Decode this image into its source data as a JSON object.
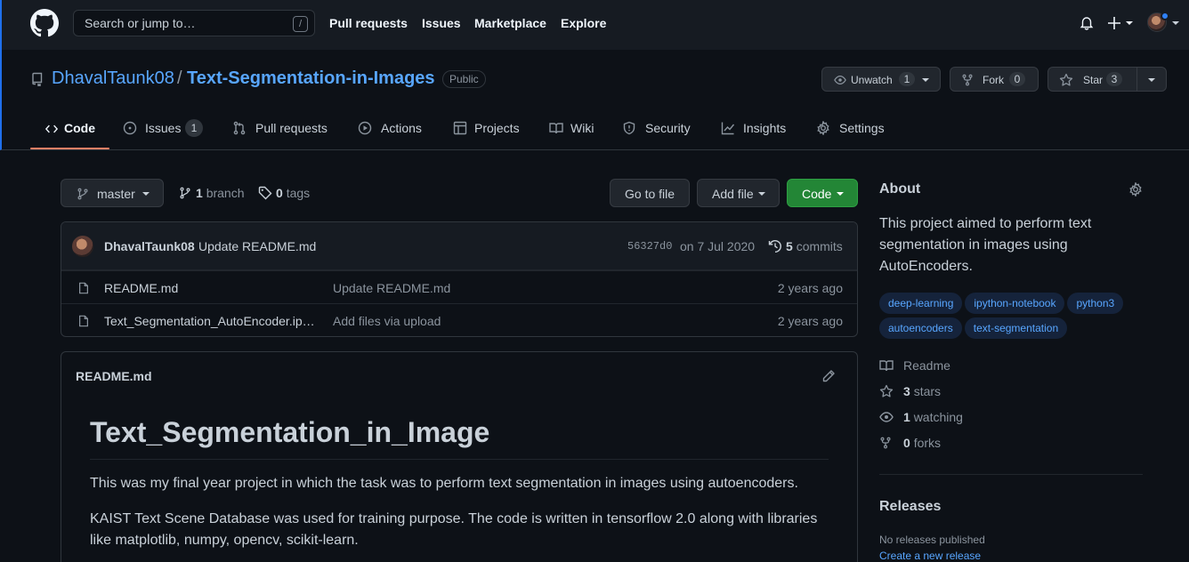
{
  "header": {
    "search_placeholder": "Search or jump to…",
    "search_shortcut": "/",
    "nav": [
      "Pull requests",
      "Issues",
      "Marketplace",
      "Explore"
    ]
  },
  "repo": {
    "owner": "DhavalTaunk08",
    "separator": "/",
    "name": "Text-Segmentation-in-Images",
    "visibility": "Public",
    "unwatch_label": "Unwatch",
    "watch_count": "1",
    "fork_label": "Fork",
    "fork_count": "0",
    "star_label": "Star",
    "star_count": "3"
  },
  "tabs": [
    {
      "label": "Code",
      "icon": "code-icon"
    },
    {
      "label": "Issues",
      "icon": "issue-icon",
      "count": "1"
    },
    {
      "label": "Pull requests",
      "icon": "pull-request-icon"
    },
    {
      "label": "Actions",
      "icon": "play-icon"
    },
    {
      "label": "Projects",
      "icon": "table-icon"
    },
    {
      "label": "Wiki",
      "icon": "book-icon"
    },
    {
      "label": "Security",
      "icon": "shield-icon"
    },
    {
      "label": "Insights",
      "icon": "graph-icon"
    },
    {
      "label": "Settings",
      "icon": "gear-icon"
    }
  ],
  "branch_bar": {
    "branch": "master",
    "branch_count": "1",
    "branch_word": "branch",
    "tag_count": "0",
    "tag_word": "tags",
    "go_to_file": "Go to file",
    "add_file": "Add file",
    "code": "Code"
  },
  "commit": {
    "author": "DhavalTaunk08",
    "message": "Update README.md",
    "sha": "56327d0",
    "date": "on 7 Jul 2020",
    "commits_count": "5",
    "commits_word": "commits"
  },
  "files": [
    {
      "name": "README.md",
      "message": "Update README.md",
      "age": "2 years ago"
    },
    {
      "name": "Text_Segmentation_AutoEncoder.ip…",
      "message": "Add files via upload",
      "age": "2 years ago"
    }
  ],
  "readme": {
    "filename": "README.md",
    "heading": "Text_Segmentation_in_Image",
    "paragraphs": [
      "This was my final year project in which the task was to perform text segmentation in images using autoencoders.",
      "KAIST Text Scene Database was used for training purpose. The code is written in tensorflow 2.0 along with libraries like matplotlib, numpy, opencv, scikit-learn."
    ]
  },
  "about": {
    "title": "About",
    "description": "This project aimed to perform text segmentation in images using AutoEncoders.",
    "topics": [
      "deep-learning",
      "ipython-notebook",
      "python3",
      "autoencoders",
      "text-segmentation"
    ],
    "readme_label": "Readme",
    "stars_count": "3",
    "stars_word": "stars",
    "watching_count": "1",
    "watching_word": "watching",
    "forks_count": "0",
    "forks_word": "forks"
  },
  "releases": {
    "title": "Releases",
    "none_text": "No releases published",
    "create_link": "Create a new release"
  },
  "colors": {
    "background": "#0d1117",
    "header": "#161b22",
    "link": "#58a6ff",
    "tab_accent": "#f78166",
    "primary_button": "#238636"
  }
}
